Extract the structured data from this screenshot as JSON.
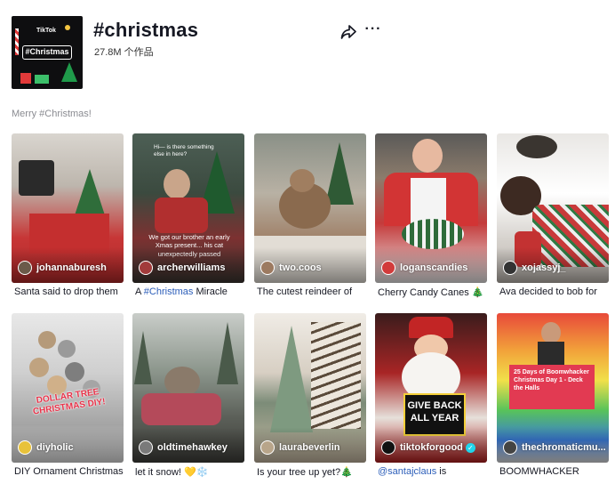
{
  "hashtag": {
    "title": "#christmas",
    "count": "27.8M 个作品",
    "description": "Merry #Christmas!",
    "avatar": {
      "brand": "TikTok",
      "tag": "#Christmas"
    }
  },
  "actions": {
    "share_icon": "share-icon",
    "more_icon": "more-icon",
    "more_glyph": "···"
  },
  "videos": [
    {
      "author": "johannaburesh",
      "caption": "Santa said to drop them",
      "avatar_color": "#6b5a4a",
      "overlay": ""
    },
    {
      "author": "archerwilliams",
      "caption_pre": "A ",
      "caption_tag": "#Christmas",
      "caption_post": " Miracle",
      "avatar_color": "#a23b3b",
      "overlay": "We got our brother an early Xmas present... his cat unexpectedly passed",
      "overlay_top": "Hi— is there something else in here?"
    },
    {
      "author": "two.coos",
      "caption": "The cutest reindeer of",
      "avatar_color": "#9c7a60",
      "overlay": ""
    },
    {
      "author": "loganscandies",
      "caption": "Cherry Candy Canes 🎄",
      "avatar_color": "#d23b3b",
      "overlay": ""
    },
    {
      "author": "xojassyj_",
      "caption": "Ava decided to bob for",
      "avatar_color": "#333333",
      "overlay": ""
    },
    {
      "author": "diyholic",
      "caption": "DIY Ornament Christmas",
      "avatar_color": "#e8c23a",
      "overlay": "DOLLAR TREE CHRISTMAS DIY!"
    },
    {
      "author": "oldtimehawkey",
      "caption": "let it snow! 💛❄️",
      "avatar_color": "#7a7a7a",
      "overlay": ""
    },
    {
      "author": "laurabeverlin",
      "caption": "Is your tree up yet?🎄",
      "avatar_color": "#b8a58a",
      "overlay": ""
    },
    {
      "author": "tiktokforgood",
      "verified": true,
      "caption_tag": "@santajclaus",
      "caption_post": " is",
      "avatar_color": "#111111",
      "overlay": "GIVE BACK ALL YEAR"
    },
    {
      "author": "thechromaticmu...",
      "caption": "BOOMWHACKER",
      "avatar_color": "#444444",
      "overlay": "25 Days of Boomwhacker Christmas Day 1 - Deck the Halls"
    }
  ]
}
